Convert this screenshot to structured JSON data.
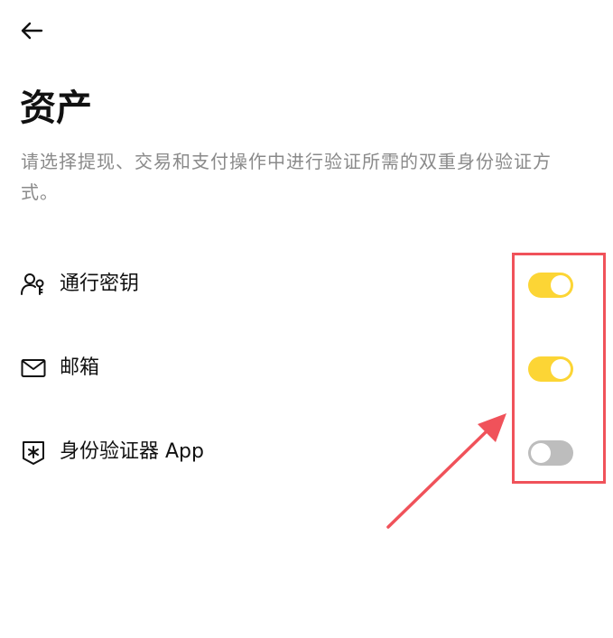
{
  "header": {
    "back_icon": "arrow-left-icon"
  },
  "page": {
    "title": "资产",
    "description": "请选择提现、交易和支付操作中进行验证所需的双重身份验证方式。"
  },
  "options": [
    {
      "label": "通行密钥",
      "icon": "passkey-user-icon",
      "enabled": true
    },
    {
      "label": "邮箱",
      "icon": "mail-icon",
      "enabled": true
    },
    {
      "label": "身份验证器 App",
      "icon": "authenticator-shield-icon",
      "enabled": false
    }
  ],
  "colors": {
    "toggle_on": "#fcd535",
    "toggle_off": "#bdbdbd",
    "annotation": "#f0525a",
    "description_text": "#8a8a8a"
  }
}
